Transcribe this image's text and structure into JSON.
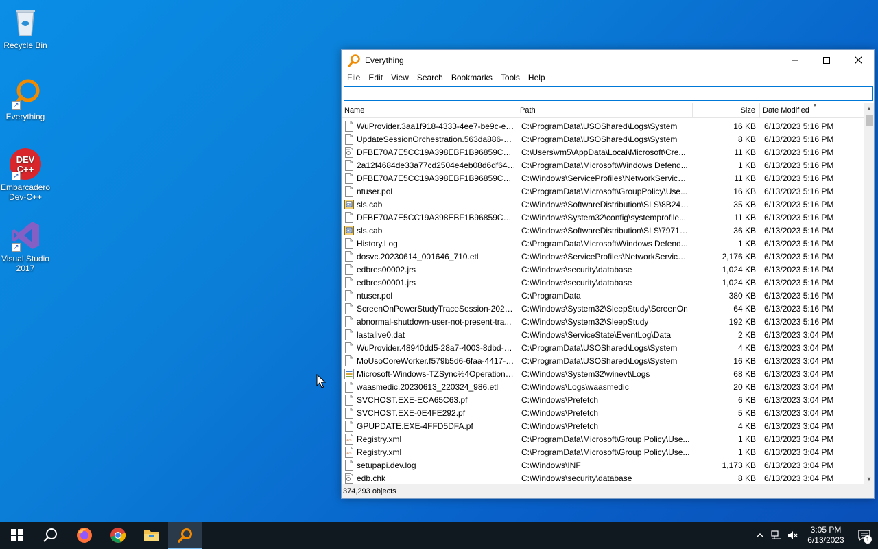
{
  "desktop": {
    "icons": [
      {
        "label": "Recycle Bin"
      },
      {
        "label": "Everything"
      },
      {
        "label": "Embarcadero Dev-C++",
        "line1": "Embarcadero",
        "line2": "Dev-C++"
      },
      {
        "label": "Visual Studio 2017",
        "line1": "Visual Studio",
        "line2": "2017"
      }
    ],
    "devcpp_logo_text": "DEV C++"
  },
  "window": {
    "title": "Everything",
    "menu": [
      "File",
      "Edit",
      "View",
      "Search",
      "Bookmarks",
      "Tools",
      "Help"
    ],
    "search_value": "",
    "columns": {
      "name": "Name",
      "path": "Path",
      "size": "Size",
      "date": "Date Modified"
    },
    "rows": [
      {
        "name": "WuProvider.3aa1f918-4333-4ee7-be9c-e5a...",
        "path": "C:\\ProgramData\\USOShared\\Logs\\System",
        "size": "16 KB",
        "date": "6/13/2023 5:16 PM",
        "icon": "file-icon"
      },
      {
        "name": "UpdateSessionOrchestration.563da886-21...",
        "path": "C:\\ProgramData\\USOShared\\Logs\\System",
        "size": "8 KB",
        "date": "6/13/2023 5:16 PM",
        "icon": "file-icon"
      },
      {
        "name": "DFBE70A7E5CC19A398EBF1B96859CE5D",
        "path": "C:\\Users\\vm5\\AppData\\Local\\Microsoft\\Cre...",
        "size": "11 KB",
        "date": "6/13/2023 5:16 PM",
        "icon": "cert-file-icon"
      },
      {
        "name": "2a12f4684de33a77cd2504e4eb08d6df649b...",
        "path": "C:\\ProgramData\\Microsoft\\Windows Defend...",
        "size": "1 KB",
        "date": "6/13/2023 5:16 PM",
        "icon": "file-icon"
      },
      {
        "name": "DFBE70A7E5CC19A398EBF1B96859CE5D",
        "path": "C:\\Windows\\ServiceProfiles\\NetworkService\\...",
        "size": "11 KB",
        "date": "6/13/2023 5:16 PM",
        "icon": "file-icon"
      },
      {
        "name": "ntuser.pol",
        "path": "C:\\ProgramData\\Microsoft\\GroupPolicy\\Use...",
        "size": "16 KB",
        "date": "6/13/2023 5:16 PM",
        "icon": "file-icon"
      },
      {
        "name": "sls.cab",
        "path": "C:\\Windows\\SoftwareDistribution\\SLS\\8B24B...",
        "size": "35 KB",
        "date": "6/13/2023 5:16 PM",
        "icon": "cab-file-icon"
      },
      {
        "name": "DFBE70A7E5CC19A398EBF1B96859CE5D",
        "path": "C:\\Windows\\System32\\config\\systemprofile...",
        "size": "11 KB",
        "date": "6/13/2023 5:16 PM",
        "icon": "file-icon"
      },
      {
        "name": "sls.cab",
        "path": "C:\\Windows\\SoftwareDistribution\\SLS\\7971F...",
        "size": "36 KB",
        "date": "6/13/2023 5:16 PM",
        "icon": "cab-file-icon"
      },
      {
        "name": "History.Log",
        "path": "C:\\ProgramData\\Microsoft\\Windows Defend...",
        "size": "1 KB",
        "date": "6/13/2023 5:16 PM",
        "icon": "file-icon"
      },
      {
        "name": "dosvc.20230614_001646_710.etl",
        "path": "C:\\Windows\\ServiceProfiles\\NetworkService\\...",
        "size": "2,176 KB",
        "date": "6/13/2023 5:16 PM",
        "icon": "file-icon"
      },
      {
        "name": "edbres00002.jrs",
        "path": "C:\\Windows\\security\\database",
        "size": "1,024 KB",
        "date": "6/13/2023 5:16 PM",
        "icon": "file-icon"
      },
      {
        "name": "edbres00001.jrs",
        "path": "C:\\Windows\\security\\database",
        "size": "1,024 KB",
        "date": "6/13/2023 5:16 PM",
        "icon": "file-icon"
      },
      {
        "name": "ntuser.pol",
        "path": "C:\\ProgramData",
        "size": "380 KB",
        "date": "6/13/2023 5:16 PM",
        "icon": "file-icon"
      },
      {
        "name": "ScreenOnPowerStudyTraceSession-2023-0...",
        "path": "C:\\Windows\\System32\\SleepStudy\\ScreenOn",
        "size": "64 KB",
        "date": "6/13/2023 5:16 PM",
        "icon": "file-icon"
      },
      {
        "name": "abnormal-shutdown-user-not-present-tra...",
        "path": "C:\\Windows\\System32\\SleepStudy",
        "size": "192 KB",
        "date": "6/13/2023 5:16 PM",
        "icon": "file-icon"
      },
      {
        "name": "lastalive0.dat",
        "path": "C:\\Windows\\ServiceState\\EventLog\\Data",
        "size": "2 KB",
        "date": "6/13/2023 3:04 PM",
        "icon": "file-icon"
      },
      {
        "name": "WuProvider.48940dd5-28a7-4003-8dbd-88...",
        "path": "C:\\ProgramData\\USOShared\\Logs\\System",
        "size": "4 KB",
        "date": "6/13/2023 3:04 PM",
        "icon": "file-icon"
      },
      {
        "name": "MoUsoCoreWorker.f579b5d6-6faa-4417-8...",
        "path": "C:\\ProgramData\\USOShared\\Logs\\System",
        "size": "16 KB",
        "date": "6/13/2023 3:04 PM",
        "icon": "file-icon"
      },
      {
        "name": "Microsoft-Windows-TZSync%4Operationa...",
        "path": "C:\\Windows\\System32\\winevt\\Logs",
        "size": "68 KB",
        "date": "6/13/2023 3:04 PM",
        "icon": "event-log-icon"
      },
      {
        "name": "waasmedic.20230613_220324_986.etl",
        "path": "C:\\Windows\\Logs\\waasmedic",
        "size": "20 KB",
        "date": "6/13/2023 3:04 PM",
        "icon": "file-icon"
      },
      {
        "name": "SVCHOST.EXE-ECA65C63.pf",
        "path": "C:\\Windows\\Prefetch",
        "size": "6 KB",
        "date": "6/13/2023 3:04 PM",
        "icon": "file-icon"
      },
      {
        "name": "SVCHOST.EXE-0E4FE292.pf",
        "path": "C:\\Windows\\Prefetch",
        "size": "5 KB",
        "date": "6/13/2023 3:04 PM",
        "icon": "file-icon"
      },
      {
        "name": "GPUPDATE.EXE-4FFD5DFA.pf",
        "path": "C:\\Windows\\Prefetch",
        "size": "4 KB",
        "date": "6/13/2023 3:04 PM",
        "icon": "file-icon"
      },
      {
        "name": "Registry.xml",
        "path": "C:\\ProgramData\\Microsoft\\Group Policy\\Use...",
        "size": "1 KB",
        "date": "6/13/2023 3:04 PM",
        "icon": "xml-file-icon"
      },
      {
        "name": "Registry.xml",
        "path": "C:\\ProgramData\\Microsoft\\Group Policy\\Use...",
        "size": "1 KB",
        "date": "6/13/2023 3:04 PM",
        "icon": "xml-file-icon"
      },
      {
        "name": "setupapi.dev.log",
        "path": "C:\\Windows\\INF",
        "size": "1,173 KB",
        "date": "6/13/2023 3:04 PM",
        "icon": "file-icon"
      },
      {
        "name": "edb.chk",
        "path": "C:\\Windows\\security\\database",
        "size": "8 KB",
        "date": "6/13/2023 3:04 PM",
        "icon": "cert-file-icon"
      }
    ],
    "status": "374,293 objects"
  },
  "taskbar": {
    "apps": [
      "start-button",
      "search",
      "firefox",
      "chrome",
      "file-explorer",
      "everything"
    ],
    "clock_time": "3:05 PM",
    "clock_date": "6/13/2023",
    "notification_count": "1"
  }
}
